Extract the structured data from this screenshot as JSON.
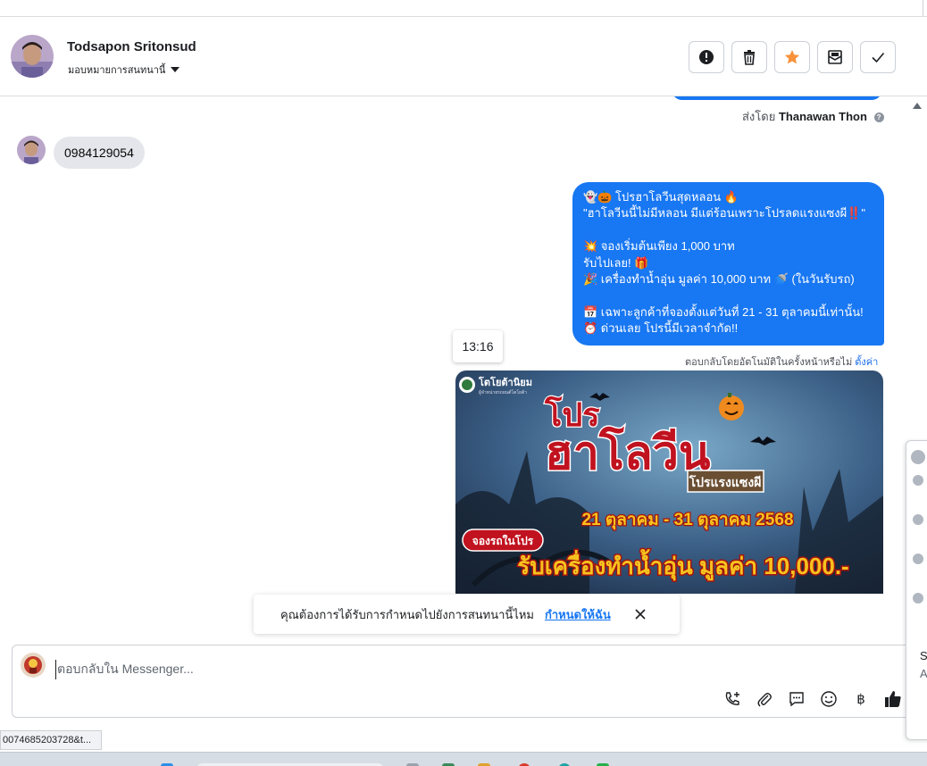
{
  "header": {
    "contact_name": "Todsapon Sritonsud",
    "assign_label": "มอบหมายการสนทนานี้",
    "actions": [
      {
        "name": "spam-button",
        "icon": "exclamation-circle-icon"
      },
      {
        "name": "delete-button",
        "icon": "trash-icon"
      },
      {
        "name": "star-button",
        "icon": "star-icon",
        "color": "#f7923b"
      },
      {
        "name": "mark-unread-button",
        "icon": "envelope-icon"
      },
      {
        "name": "done-button",
        "icon": "check-icon"
      }
    ]
  },
  "thread": {
    "sent_by_prefix": "ส่งโดย",
    "sent_by_name": "Thanawan Thon",
    "incoming_message": "0984129054",
    "outgoing_message": "👻🎃 โปรฮาโลวีนสุดหลอน 🔥\n\"ฮาโลวีนนี้ไม่มีหลอน มีแต่ร้อนเพราะโปรลดแรงแซงผี‼️\"\n\n💥 จองเริ่มต้นเพียง 1,000 บาท\nรับไปเลย! 🎁\n🎉 เครื่องทำน้ำอุ่น มูลค่า 10,000 บาท 🚿 (ในวันรับรถ)\n\n📅 เฉพาะลูกค้าที่จองตั้งแต่วันที่ 21 - 31 ตุลาคมนี้เท่านั้น!\n⏰ ด่วนเลย โปรนี้มีเวลาจำกัด!!",
    "auto_reply_note": "ตอบกลับโดยอัตโนมัติในครั้งหน้าหรือไม่",
    "auto_reply_link": "ตั้งค่า",
    "time_chip": "13:16",
    "promo_image": {
      "brand": "โตโยต้านิยม",
      "brand_sub": "ผู้จำหน่ายรถยนต์โตโยต้า",
      "title_line1": "โปร",
      "title_line2": "ฮาโลวีน",
      "badge": "โปรแรงแซงผี",
      "dates": "21 ตุลาคม - 31 ตุลาคม 2568",
      "book_tag": "จองรถในโปร",
      "gift": "รับเครื่องทำน้ำอุ่น มูลค่า 10,000.-"
    }
  },
  "toast": {
    "question": "คุณต้องการได้รับการกำหนดไปยังการสนทนานี้ไหม",
    "assign_link": "กำหนดให้ฉัน"
  },
  "composer": {
    "placeholder": "ตอบกลับใน Messenger...",
    "tools": [
      {
        "name": "call-add-icon"
      },
      {
        "name": "attachment-icon"
      },
      {
        "name": "saved-reply-icon"
      },
      {
        "name": "emoji-icon"
      },
      {
        "name": "baht-payment-icon",
        "glyph": "฿"
      },
      {
        "name": "like-icon"
      }
    ]
  },
  "status_bar": {
    "url_fragment": "0074685203728&t..."
  },
  "side_panel": {
    "letter_s": "S",
    "letter_a": "A"
  },
  "colors": {
    "messenger_blue": "#1877f2",
    "incoming_gray": "#e4e6eb",
    "star_orange": "#f7923b",
    "link_blue": "#1c6ee8"
  }
}
